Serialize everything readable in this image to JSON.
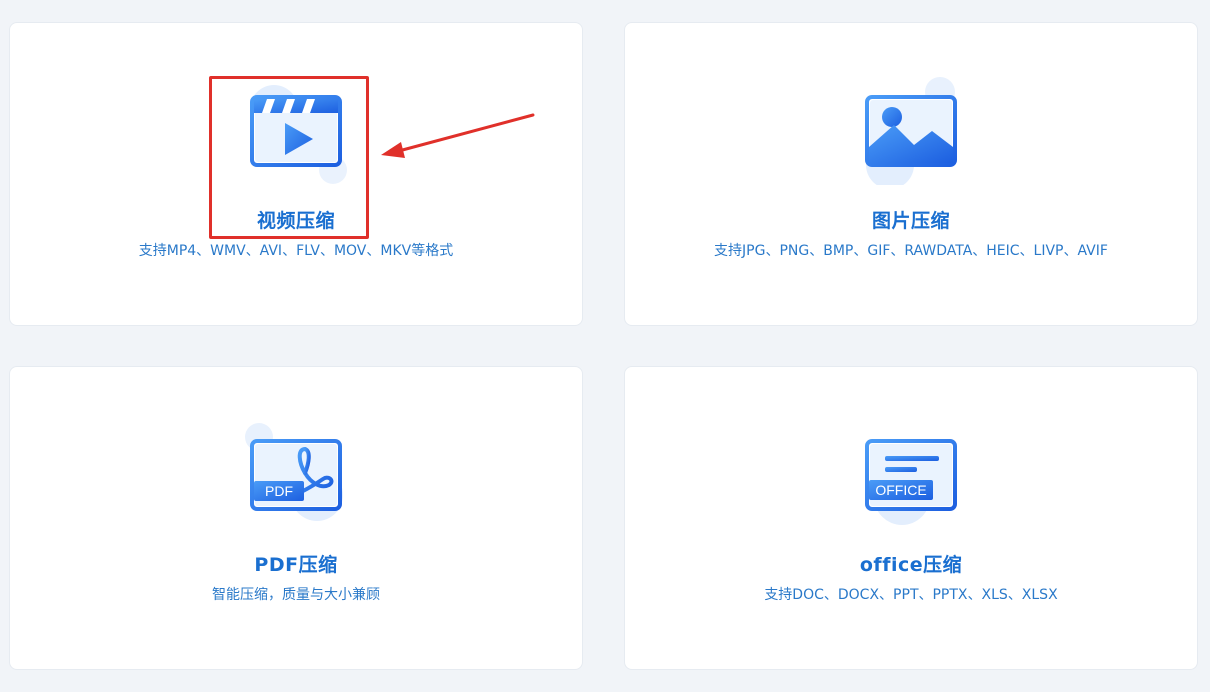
{
  "cards": [
    {
      "title": "视频压缩",
      "desc": "支持MP4、WMV、AVI、FLV、MOV、MKV等格式",
      "icon": "video-icon"
    },
    {
      "title": "图片压缩",
      "desc": "支持JPG、PNG、BMP、GIF、RAWDATA、HEIC、LIVP、AVIF",
      "icon": "image-icon"
    },
    {
      "title": "PDF压缩",
      "desc": "智能压缩，质量与大小兼顾",
      "icon": "pdf-icon",
      "icon_label": "PDF"
    },
    {
      "title": "office压缩",
      "desc": "支持DOC、DOCX、PPT、PPTX、XLS、XLSX",
      "icon": "office-icon",
      "icon_label": "OFFICE"
    }
  ],
  "colors": {
    "accent": "#1a6fd0",
    "icon_blue": "#2d7cf0",
    "annotation_red": "#e0302a",
    "background": "#f1f4f8"
  }
}
